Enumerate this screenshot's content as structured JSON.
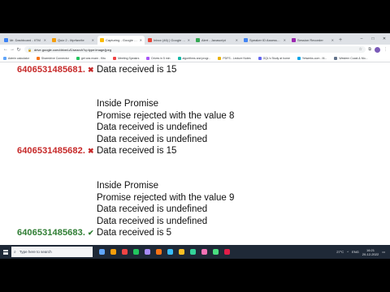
{
  "tabs": [
    {
      "label": "Mr. Dashboard - IITM",
      "color": "#3b82f6",
      "active": false
    },
    {
      "label": "Quiz 2 - Iitprfavrite",
      "color": "#f59e0b",
      "active": false
    },
    {
      "label": "Capturing - Google Drive",
      "color": "#fbbc04",
      "active": true
    },
    {
      "label": "Inbox (46) | Google Drive",
      "color": "#ea4335",
      "active": false
    },
    {
      "label": "Alert - Javascript",
      "color": "#34a853",
      "active": false
    },
    {
      "label": "Speaker ID Assessment",
      "color": "#4285f4",
      "active": false
    },
    {
      "label": "Session Recorder",
      "color": "#9c27b0",
      "active": false
    }
  ],
  "window_controls": [
    "–",
    "□",
    "✕"
  ],
  "omnibox": {
    "url": "drive.google.com/drive/u/1/search?q=type:image/jpeg"
  },
  "bookmarks": [
    {
      "label": "Admin calculator",
      "color": "#60a5fa"
    },
    {
      "label": "Sharedrive Connector",
      "color": "#f97316"
    },
    {
      "label": "get ans exam - Kitu",
      "color": "#22c55e"
    },
    {
      "label": "Meeting Speakrs",
      "color": "#ef4444"
    },
    {
      "label": "Drives in 5 min",
      "color": "#a855f7"
    },
    {
      "label": "algorithms and progr...",
      "color": "#14b8a6"
    },
    {
      "label": "PDFS - Lecture Notes",
      "color": "#eab308"
    },
    {
      "label": "GQL's Study at home",
      "color": "#6366f1"
    },
    {
      "label": "Yeiwerks.com - M...",
      "color": "#0ea5e9"
    },
    {
      "label": "Western Coast & Mo...",
      "color": "#64748b"
    }
  ],
  "results": [
    {
      "roll": "6406531485681.",
      "status": "fail",
      "mark": "✖",
      "lines": [
        "Data received is 15"
      ]
    },
    {
      "roll": "6406531485682.",
      "status": "fail",
      "mark": "✖",
      "lines": [
        "Inside Promise",
        "Promise rejected with the value 8",
        "Data received is undefined",
        "Data received is undefined",
        "Data received is 15"
      ]
    },
    {
      "roll": "6406531485683.",
      "status": "pass",
      "mark": "✔",
      "lines": [
        "Inside Promise",
        "Promise rejected with the value 9",
        "Data received is undefined",
        "Data received is undefined",
        "Data received is 5"
      ]
    }
  ],
  "taskbar": {
    "search_placeholder": "Type here to search",
    "apps": [
      "#60a5fa",
      "#f59e0b",
      "#ef4444",
      "#22c55e",
      "#a78bfa",
      "#f97316",
      "#38bdf8",
      "#fbbf24",
      "#34d399",
      "#f472b6",
      "#4ade80",
      "#e11d48"
    ],
    "weather": "27°C",
    "lang": "ENG",
    "time": "16:21",
    "date": "20-12-2022"
  }
}
